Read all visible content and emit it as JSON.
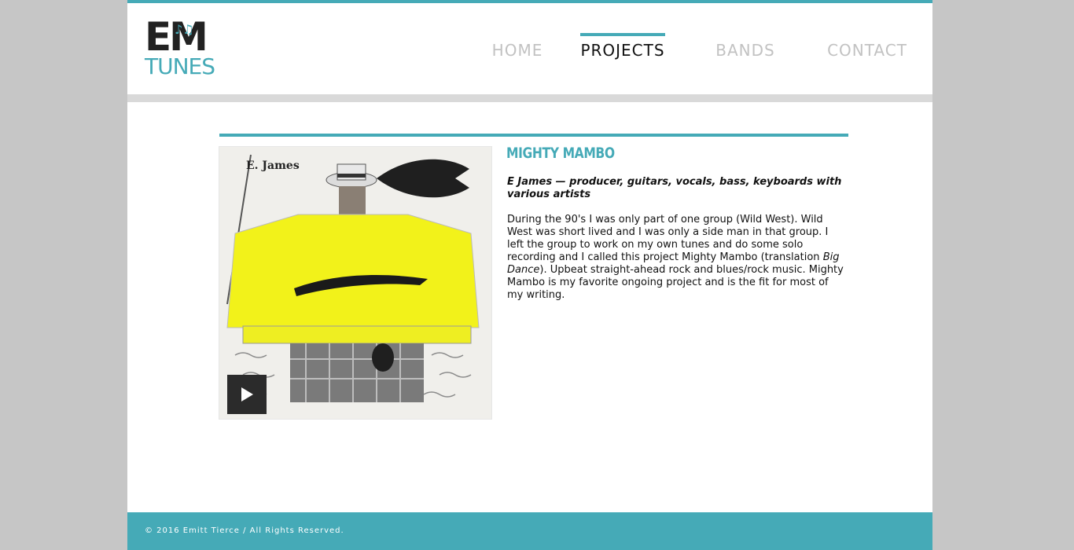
{
  "brand": {
    "logo_top": "EM",
    "logo_bottom": "TUNES",
    "logo_notes": "♪♫"
  },
  "nav": {
    "items": [
      {
        "label": "HOME"
      },
      {
        "label": "PROJECTS"
      },
      {
        "label": "BANDS"
      },
      {
        "label": "CONTACT"
      }
    ],
    "active": "PROJECTS"
  },
  "project": {
    "title": "MIGHTY MAMBO",
    "cover_artist": "E. James",
    "credits": "E James — producer, guitars, vocals, bass, keyboards with various artists",
    "description_part1": "During the 90's I was only part of one group (Wild West). Wild West was short lived and I was only a side man in that group. I left the group to work on my own tunes and do some solo recording and I called this project Mighty Mambo (translation ",
    "description_italic": "Big Dance",
    "description_part2": "). Upbeat straight-ahead rock and blues/rock music. Mighty Mambo is my favorite ongoing project and is the fit for most of my writing."
  },
  "footer": {
    "copyright": "© 2016 Emitt Tierce / All Rights Reserved."
  },
  "colors": {
    "accent": "#45aab7",
    "background": "#c6c6c6",
    "nav_inactive": "#c2c2c2",
    "nav_active": "#111111"
  },
  "icons": {
    "play": "play-icon"
  }
}
